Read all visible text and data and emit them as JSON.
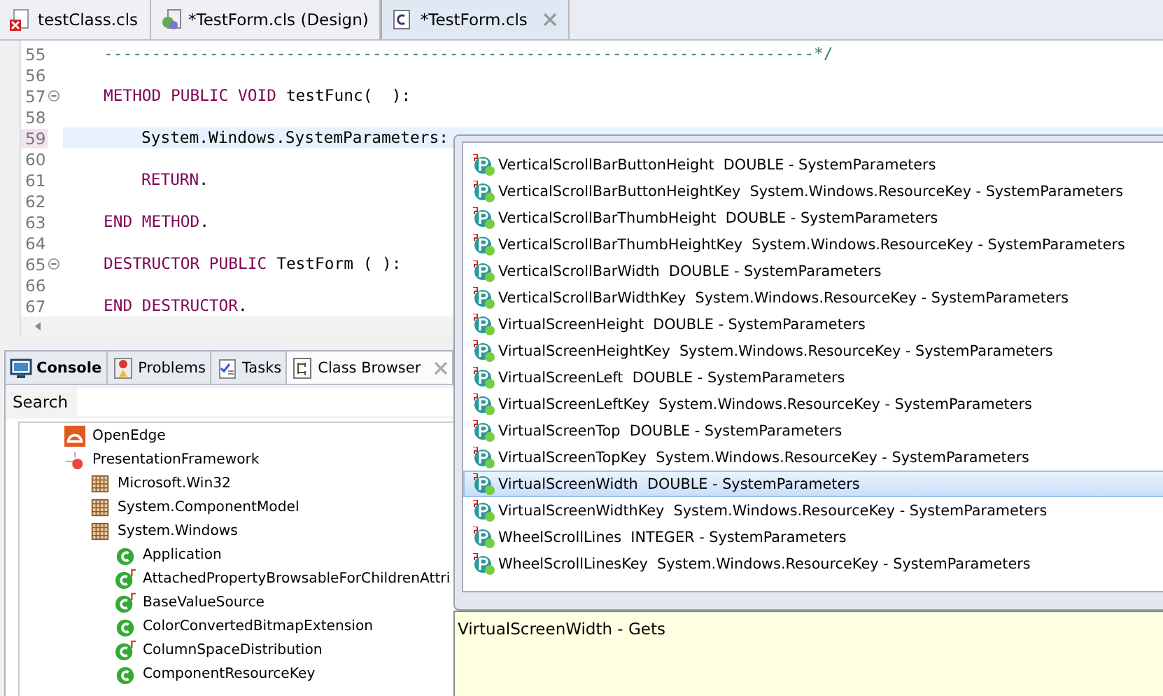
{
  "editor_tabs": [
    {
      "label": "testClass.cls",
      "kind": "class-error",
      "selected": false,
      "closable": false
    },
    {
      "label": "*TestForm.cls (Design)",
      "kind": "design",
      "selected": false,
      "closable": false
    },
    {
      "label": "*TestForm.cls",
      "kind": "class",
      "selected": true,
      "closable": true
    }
  ],
  "code": {
    "lines": [
      {
        "number": "55",
        "current": false,
        "fold": false,
        "tokens": [
          {
            "text": "--------------------------------------------------------------------------*/",
            "kind": "comment"
          }
        ]
      },
      {
        "number": "56",
        "current": false,
        "fold": false
      },
      {
        "number": "57",
        "current": false,
        "fold": true,
        "tokens": [
          {
            "text": "METHOD PUBLIC VOID",
            "kind": "keyword"
          },
          {
            "text": "testFunc(  ):",
            "kind": "plain"
          }
        ],
        "children": [
          {
            "number": "58",
            "current": false,
            "fold": false
          },
          {
            "number": "59",
            "current": true,
            "fold": false,
            "tokens": [
              {
                "text": "System.Windows.SystemParameters:",
                "kind": "plain"
              }
            ]
          },
          {
            "number": "60",
            "current": false,
            "fold": false
          },
          {
            "number": "61",
            "current": false,
            "fold": false,
            "tokens": [
              {
                "text": "RETURN",
                "kind": "keyword"
              },
              {
                "text": ".",
                "kind": "punct"
              }
            ]
          },
          {
            "number": "62",
            "current": false,
            "fold": false
          }
        ]
      },
      {
        "number": "63",
        "current": false,
        "fold": false,
        "tokens": [
          {
            "text": "END METHOD",
            "kind": "keyword"
          },
          {
            "text": ".",
            "kind": "punct"
          }
        ]
      },
      {
        "number": "64",
        "current": false,
        "fold": false
      },
      {
        "number": "65",
        "current": false,
        "fold": true,
        "tokens": [
          {
            "text": "DESTRUCTOR PUBLIC",
            "kind": "keyword"
          },
          {
            "text": "TestForm ( ):",
            "kind": "plain"
          }
        ]
      },
      {
        "number": "66",
        "current": false,
        "fold": false
      },
      {
        "number": "67",
        "current": false,
        "fold": false,
        "tokens": [
          {
            "text": "END DESTRUCTOR",
            "kind": "keyword"
          },
          {
            "text": ".",
            "kind": "punct"
          }
        ]
      }
    ]
  },
  "panel_tabs": [
    {
      "label": "Console",
      "kind": "console",
      "selected": false,
      "bold": true,
      "closable": false
    },
    {
      "label": "Problems",
      "kind": "problems",
      "selected": false,
      "bold": false,
      "closable": false
    },
    {
      "label": "Tasks",
      "kind": "tasks",
      "selected": false,
      "bold": false,
      "closable": false
    },
    {
      "label": "Class Browser",
      "kind": "browser",
      "selected": true,
      "bold": false,
      "closable": true
    }
  ],
  "search": {
    "label": "Search"
  },
  "tree": [
    {
      "label": "OpenEdge",
      "kind": "product"
    },
    {
      "label": "PresentationFramework",
      "kind": "assembly",
      "children": [
        {
          "label": "Microsoft.Win32",
          "kind": "namespace"
        },
        {
          "label": "System.ComponentModel",
          "kind": "namespace"
        },
        {
          "label": "System.Windows",
          "kind": "namespace",
          "children": [
            {
              "label": "Application",
              "kind": "class"
            },
            {
              "label": "AttachedPropertyBrowsableForChildrenAttri",
              "kind": "final-class"
            },
            {
              "label": "BaseValueSource",
              "kind": "final-class"
            },
            {
              "label": "ColorConvertedBitmapExtension",
              "kind": "class"
            },
            {
              "label": "ColumnSpaceDistribution",
              "kind": "final-class"
            },
            {
              "label": "ComponentResourceKey",
              "kind": "class"
            }
          ]
        }
      ]
    }
  ],
  "completion": {
    "items": [
      {
        "text": "VerticalScrollBarButtonHeight  DOUBLE - SystemParameters",
        "selected": false
      },
      {
        "text": "VerticalScrollBarButtonHeightKey  System.Windows.ResourceKey - SystemParameters",
        "selected": false
      },
      {
        "text": "VerticalScrollBarThumbHeight  DOUBLE - SystemParameters",
        "selected": false
      },
      {
        "text": "VerticalScrollBarThumbHeightKey  System.Windows.ResourceKey - SystemParameters",
        "selected": false
      },
      {
        "text": "VerticalScrollBarWidth  DOUBLE - SystemParameters",
        "selected": false
      },
      {
        "text": "VerticalScrollBarWidthKey  System.Windows.ResourceKey - SystemParameters",
        "selected": false
      },
      {
        "text": "VirtualScreenHeight  DOUBLE - SystemParameters",
        "selected": false
      },
      {
        "text": "VirtualScreenHeightKey  System.Windows.ResourceKey - SystemParameters",
        "selected": false
      },
      {
        "text": "VirtualScreenLeft  DOUBLE - SystemParameters",
        "selected": false
      },
      {
        "text": "VirtualScreenLeftKey  System.Windows.ResourceKey - SystemParameters",
        "selected": false
      },
      {
        "text": "VirtualScreenTop  DOUBLE - SystemParameters",
        "selected": false
      },
      {
        "text": "VirtualScreenTopKey  System.Windows.ResourceKey - SystemParameters",
        "selected": false
      },
      {
        "text": "VirtualScreenWidth  DOUBLE - SystemParameters",
        "selected": true
      },
      {
        "text": "VirtualScreenWidthKey  System.Windows.ResourceKey - SystemParameters",
        "selected": false
      },
      {
        "text": "WheelScrollLines  INTEGER - SystemParameters",
        "selected": false
      },
      {
        "text": "WheelScrollLinesKey  System.Windows.ResourceKey - SystemParameters",
        "selected": false
      }
    ],
    "info": "VirtualScreenWidth - Gets"
  }
}
